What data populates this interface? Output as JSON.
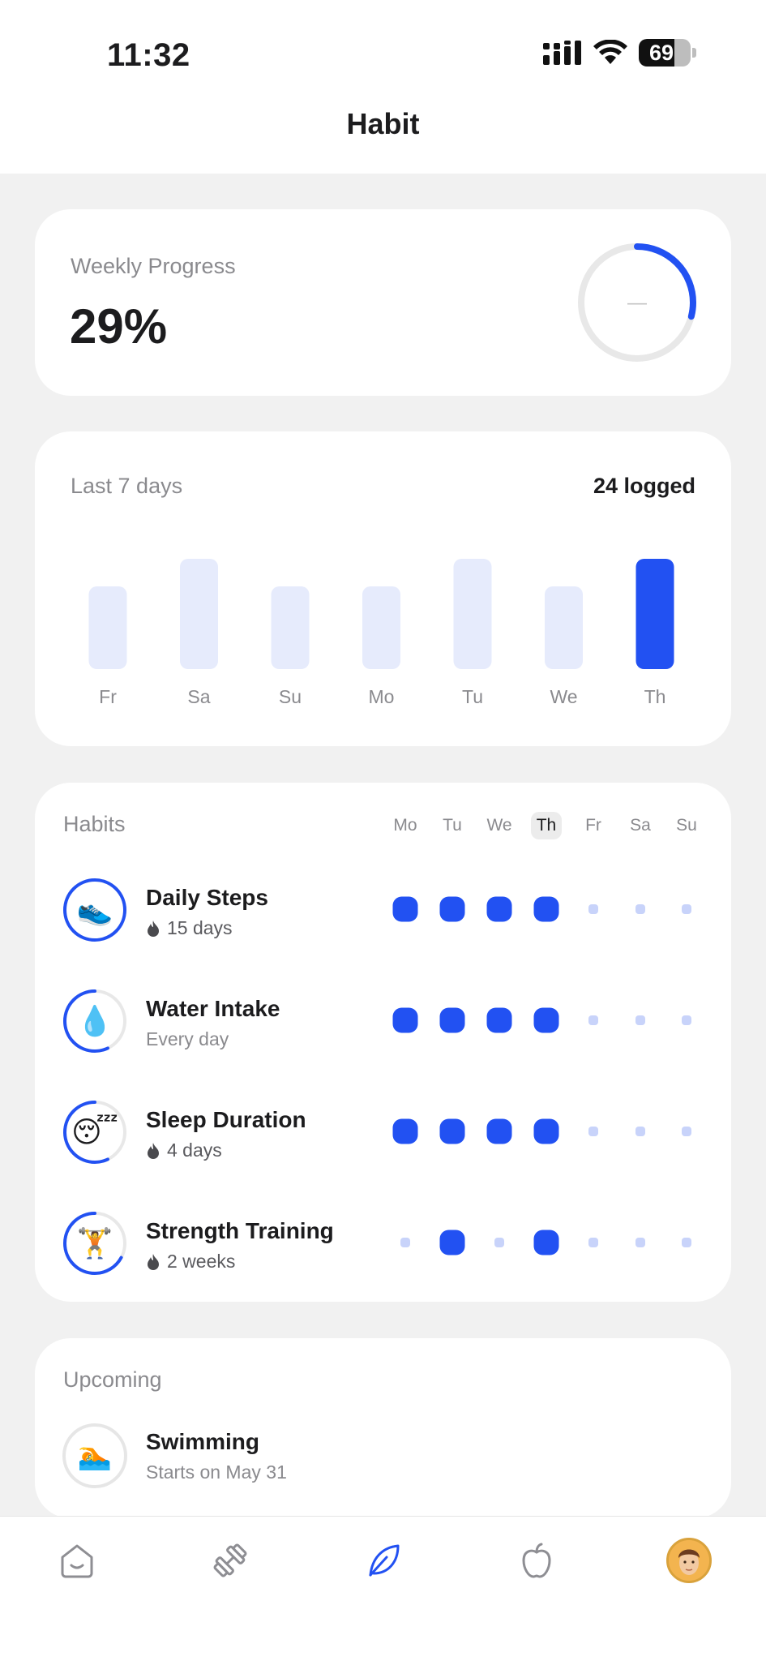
{
  "status": {
    "time": "11:32",
    "battery": "69",
    "battery_level": 0.69
  },
  "header": {
    "title": "Habit"
  },
  "weekly_progress": {
    "label": "Weekly Progress",
    "value": "29%",
    "fraction": 0.29,
    "center_symbol": "—"
  },
  "last7": {
    "label": "Last 7 days",
    "logged": "24 logged",
    "chart_data": {
      "type": "bar",
      "categories": [
        "Fr",
        "Sa",
        "Su",
        "Mo",
        "Tu",
        "We",
        "Th"
      ],
      "values": [
        3,
        4,
        3,
        3,
        4,
        3,
        4
      ],
      "highlight_index": 6,
      "ylim": [
        0,
        4
      ]
    }
  },
  "habits": {
    "title": "Habits",
    "days": [
      "Mo",
      "Tu",
      "We",
      "Th",
      "Fr",
      "Sa",
      "Su"
    ],
    "today_index": 3,
    "items": [
      {
        "name": "Daily Steps",
        "sub": "15 days",
        "streak": true,
        "icon": "sneaker-icon",
        "emoji": "👟",
        "progress": 1.0,
        "done": [
          1,
          1,
          1,
          1,
          0,
          0,
          0
        ]
      },
      {
        "name": "Water Intake",
        "sub": "Every day",
        "streak": false,
        "icon": "droplet-icon",
        "emoji": "💧",
        "progress": 0.57,
        "done": [
          1,
          1,
          1,
          1,
          0,
          0,
          0
        ]
      },
      {
        "name": "Sleep Duration",
        "sub": "4 days",
        "streak": true,
        "icon": "sleeping-face-icon",
        "emoji": "😴",
        "progress": 0.57,
        "done": [
          1,
          1,
          1,
          1,
          0,
          0,
          0
        ]
      },
      {
        "name": "Strength Training",
        "sub": "2 weeks",
        "streak": true,
        "icon": "weightlifter-icon",
        "emoji": "🏋️",
        "progress": 0.67,
        "done": [
          0,
          1,
          0,
          1,
          0,
          0,
          0
        ]
      }
    ]
  },
  "upcoming": {
    "title": "Upcoming",
    "items": [
      {
        "name": "Swimming",
        "sub": "Starts on May 31",
        "icon": "swimmer-icon",
        "emoji": "🏊"
      }
    ]
  },
  "tabs": [
    {
      "name": "home-tab",
      "icon": "home-icon",
      "active": false
    },
    {
      "name": "workout-tab",
      "icon": "dumbbell-icon",
      "active": false
    },
    {
      "name": "habit-tab",
      "icon": "leaf-icon",
      "active": true
    },
    {
      "name": "nutrition-tab",
      "icon": "apple-icon",
      "active": false
    },
    {
      "name": "profile-tab",
      "icon": "avatar-icon",
      "active": false
    }
  ],
  "colors": {
    "accent": "#2251f2",
    "accent_light": "#e6ebfc",
    "dot_inactive": "#c8d3fa",
    "ring_track": "#e8e8e8"
  }
}
